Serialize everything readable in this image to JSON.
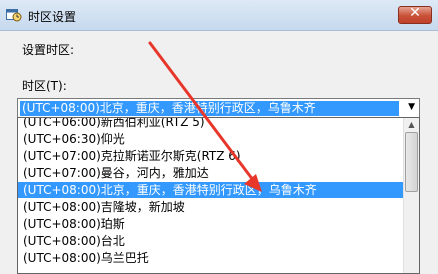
{
  "window": {
    "title": "时区设置",
    "close_label": "✕"
  },
  "dialog": {
    "setting_label": "设置时区:",
    "timezone_label": "时区(T):"
  },
  "combo": {
    "selected": "(UTC+08:00)北京，重庆，香港特别行政区，乌鲁木齐"
  },
  "list": {
    "items": [
      "(UTC+06:00)新西伯利亚(RTZ 5)",
      "(UTC+06:30)仰光",
      "(UTC+07:00)克拉斯诺亚尔斯克(RTZ 6)",
      "(UTC+07:00)曼谷，河内，雅加达",
      "(UTC+08:00)北京，重庆，香港特别行政区，乌鲁木齐",
      "(UTC+08:00)吉隆坡，新加坡",
      "(UTC+08:00)珀斯",
      "(UTC+08:00)台北",
      "(UTC+08:00)乌兰巴托"
    ],
    "selected_index": 4
  },
  "colors": {
    "selection": "#3399ff",
    "annotation_arrow": "#e8372a"
  }
}
